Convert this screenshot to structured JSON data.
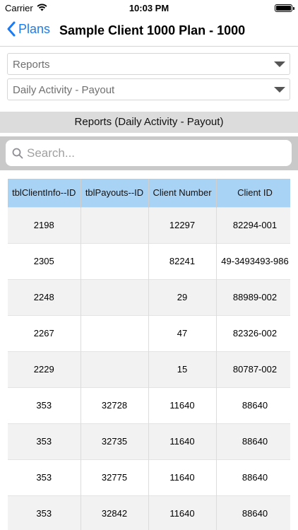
{
  "status_bar": {
    "carrier": "Carrier",
    "time": "10:03 PM"
  },
  "nav": {
    "back_label": "Plans",
    "title": "Sample Client 1000 Plan - 1000"
  },
  "dropdowns": [
    {
      "value": "Reports"
    },
    {
      "value": "Daily Activity - Payout"
    }
  ],
  "section_header": "Reports (Daily Activity - Payout)",
  "search": {
    "placeholder": "Search..."
  },
  "table": {
    "headers": [
      "tblClientInfo--ID",
      "tblPayouts--ID",
      "Client Number",
      "Client ID"
    ],
    "rows": [
      [
        "2198",
        "",
        "12297",
        "82294-001"
      ],
      [
        "2305",
        "",
        "82241",
        "49-3493493-986"
      ],
      [
        "2248",
        "",
        "29",
        "88989-002"
      ],
      [
        "2267",
        "",
        "47",
        "82326-002"
      ],
      [
        "2229",
        "",
        "15",
        "80787-002"
      ],
      [
        "353",
        "32728",
        "11640",
        "88640"
      ],
      [
        "353",
        "32735",
        "11640",
        "88640"
      ],
      [
        "353",
        "32775",
        "11640",
        "88640"
      ],
      [
        "353",
        "32842",
        "11640",
        "88640"
      ]
    ]
  },
  "colors": {
    "accent": "#1a7cf5",
    "table_header": "#a9d3f5",
    "section_header": "#dcdcdc",
    "search_bar_bg": "#c9c9c9"
  },
  "icons": [
    "wifi-icon",
    "battery-icon",
    "chevron-left-icon",
    "search-icon",
    "chevron-down-icon"
  ]
}
